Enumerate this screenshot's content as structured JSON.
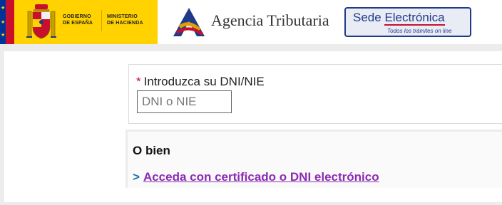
{
  "header": {
    "gov_line1": "GOBIERNO",
    "gov_line2": "DE ESPAÑA",
    "ministry_line1": "MINISTERIO",
    "ministry_line2": "DE HACIENDA",
    "agency_name": "Agencia Tributaria",
    "sede_title_part1": "Sede ",
    "sede_title_part2": "Electrónica",
    "sede_subtitle": "Todos los trámites on line"
  },
  "form": {
    "required_mark": "*",
    "dni_label": "Introduzca su DNI/NIE",
    "dni_placeholder": "DNI o NIE",
    "dni_value": ""
  },
  "alternative": {
    "heading": "O bien",
    "arrow": ">",
    "cert_link": "Acceda con certificado o DNI electrónico"
  },
  "colors": {
    "gov_yellow": "#ffd200",
    "spain_red": "#c8102e",
    "sede_blue": "#1f3a8a",
    "link_purple": "#8b2ab3",
    "arrow_blue": "#1f6fb5"
  }
}
